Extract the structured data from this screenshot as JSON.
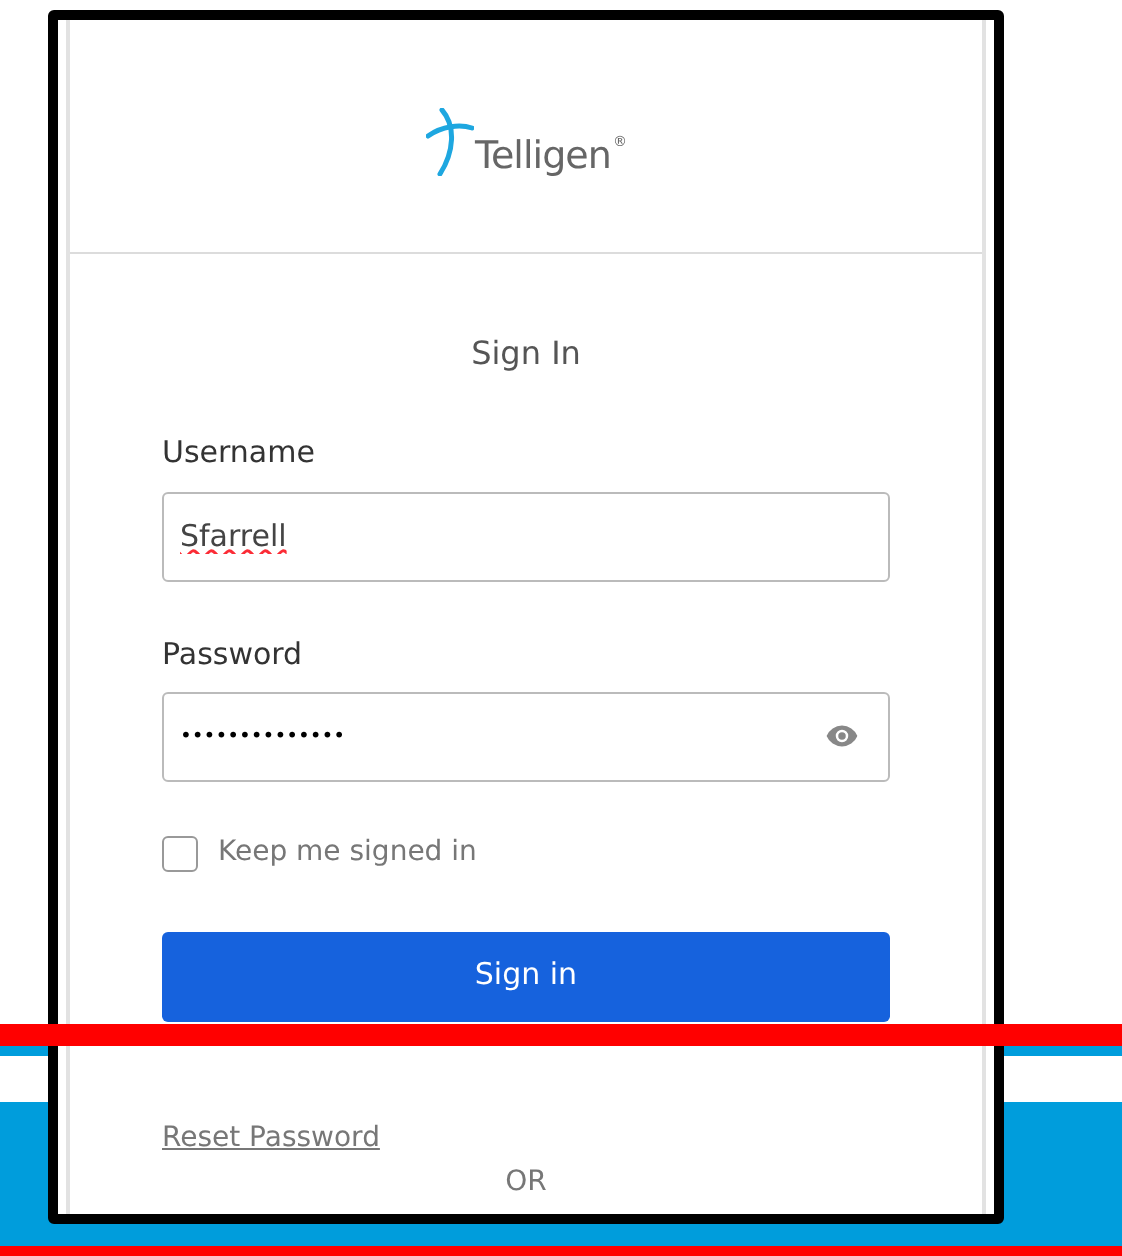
{
  "logo": {
    "name": "Telligen",
    "mark": "®"
  },
  "form": {
    "title": "Sign In",
    "username": {
      "label": "Username",
      "value": "Sfarrell"
    },
    "password": {
      "label": "Password",
      "value": "••••••••••••••"
    },
    "keep_signed_in": {
      "label": "Keep me signed in",
      "checked": false
    },
    "submit": "Sign in",
    "reset_link": "Reset Password",
    "divider_text": "OR"
  }
}
